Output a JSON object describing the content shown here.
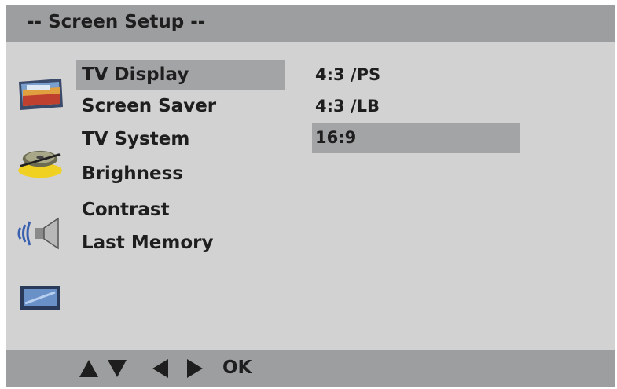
{
  "screen": {
    "title": "-- Screen  Setup --"
  },
  "icons": [
    "monitor-picture-icon",
    "disc-icon",
    "speaker-icon",
    "screen-icon"
  ],
  "menu": {
    "items": [
      {
        "label": "TV Display",
        "selected": true
      },
      {
        "label": "Screen Saver",
        "selected": false
      },
      {
        "label": "TV System",
        "selected": false
      },
      {
        "label": "Brighness",
        "selected": false
      },
      {
        "label": "Contrast",
        "selected": false
      },
      {
        "label": "Last Memory",
        "selected": false
      }
    ]
  },
  "options": {
    "items": [
      {
        "label": "4:3 /PS",
        "selected": false
      },
      {
        "label": "4:3 /LB",
        "selected": false
      },
      {
        "label": "16:9",
        "selected": true
      }
    ]
  },
  "nav": {
    "buttons": [
      "up-arrow-icon",
      "down-arrow-icon",
      "left-arrow-icon",
      "right-arrow-icon"
    ],
    "ok_label": "OK"
  },
  "colors": {
    "background": "#d2d2d3",
    "bars": "#9d9e9f",
    "highlight": "#a3a4a5",
    "text": "#1e1e1e"
  }
}
